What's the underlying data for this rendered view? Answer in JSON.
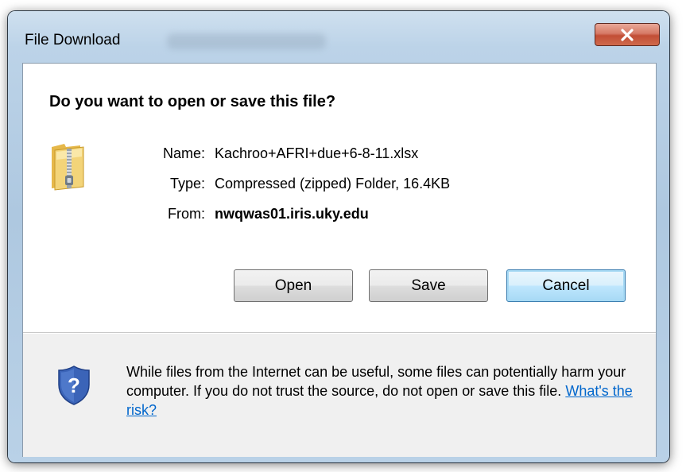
{
  "window": {
    "title": "File Download",
    "close_label": "X"
  },
  "dialog": {
    "question": "Do you want to open or save this file?",
    "icon": "zipped-folder-icon",
    "fields": {
      "name_label": "Name:",
      "name_value": "Kachroo+AFRI+due+6-8-11.xlsx",
      "type_label": "Type:",
      "type_value": "Compressed (zipped) Folder, 16.4KB",
      "from_label": "From:",
      "from_value": "nwqwas01.iris.uky.edu"
    },
    "buttons": {
      "open": "Open",
      "save": "Save",
      "cancel": "Cancel"
    }
  },
  "warning": {
    "icon": "security-shield-question-icon",
    "text": "While files from the Internet can be useful, some files can potentially harm your computer. If you do not trust the source, do not open or save this file. ",
    "link": "What's the risk?"
  },
  "colors": {
    "link": "#0066cc",
    "default_button_border": "#3c7fb1",
    "close_button": "#c24e36"
  }
}
